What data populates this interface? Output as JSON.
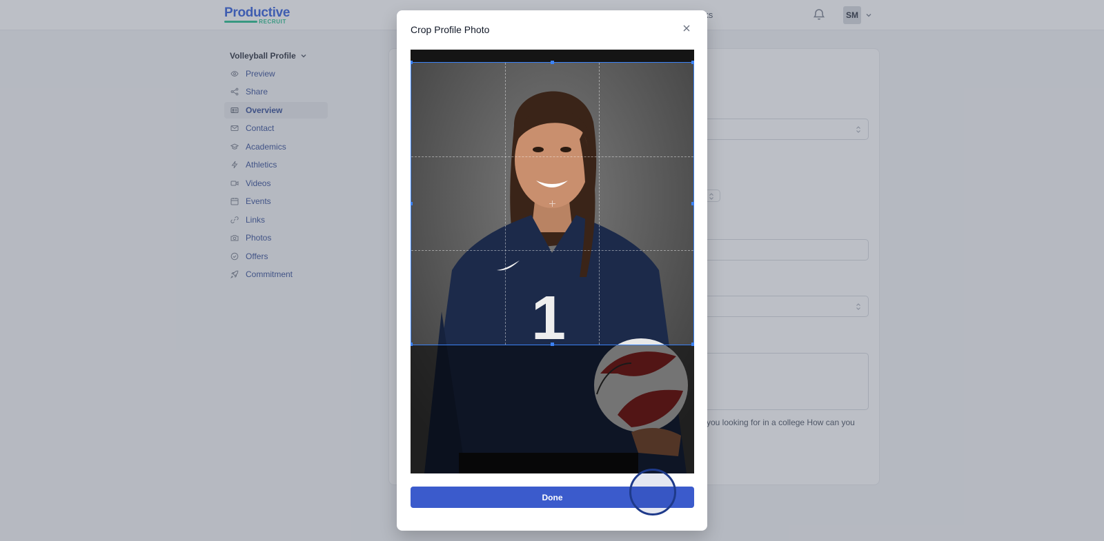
{
  "brand": {
    "name": "Productive",
    "sub": "RECRUIT",
    "color_primary": "#1d4ed8",
    "color_secondary": "#10b981"
  },
  "header": {
    "nav_link": "Tasks",
    "bell_icon": "bell-icon",
    "avatar_initials": "SM"
  },
  "sidebar": {
    "title": "Volleyball Profile",
    "items": [
      {
        "label": "Preview",
        "icon": "eye-icon"
      },
      {
        "label": "Share",
        "icon": "share-icon"
      },
      {
        "label": "Overview",
        "icon": "id-card-icon",
        "active": true
      },
      {
        "label": "Contact",
        "icon": "mail-icon"
      },
      {
        "label": "Academics",
        "icon": "graduation-cap-icon"
      },
      {
        "label": "Athletics",
        "icon": "bolt-icon"
      },
      {
        "label": "Videos",
        "icon": "video-icon"
      },
      {
        "label": "Events",
        "icon": "calendar-icon"
      },
      {
        "label": "Links",
        "icon": "link-icon"
      },
      {
        "label": "Photos",
        "icon": "camera-icon"
      },
      {
        "label": "Offers",
        "icon": "check-circle-icon"
      },
      {
        "label": "Commitment",
        "icon": "rocket-icon"
      }
    ]
  },
  "main": {
    "fragment_label": "t:",
    "fragment_hint": "you looking for in a college How can you"
  },
  "modal": {
    "title": "Crop Profile Photo",
    "done_label": "Done",
    "image_subject": "volleyball player photo",
    "jersey_number": "1",
    "crop_color": "#3b82f6",
    "button_color": "#3b5bcc"
  }
}
